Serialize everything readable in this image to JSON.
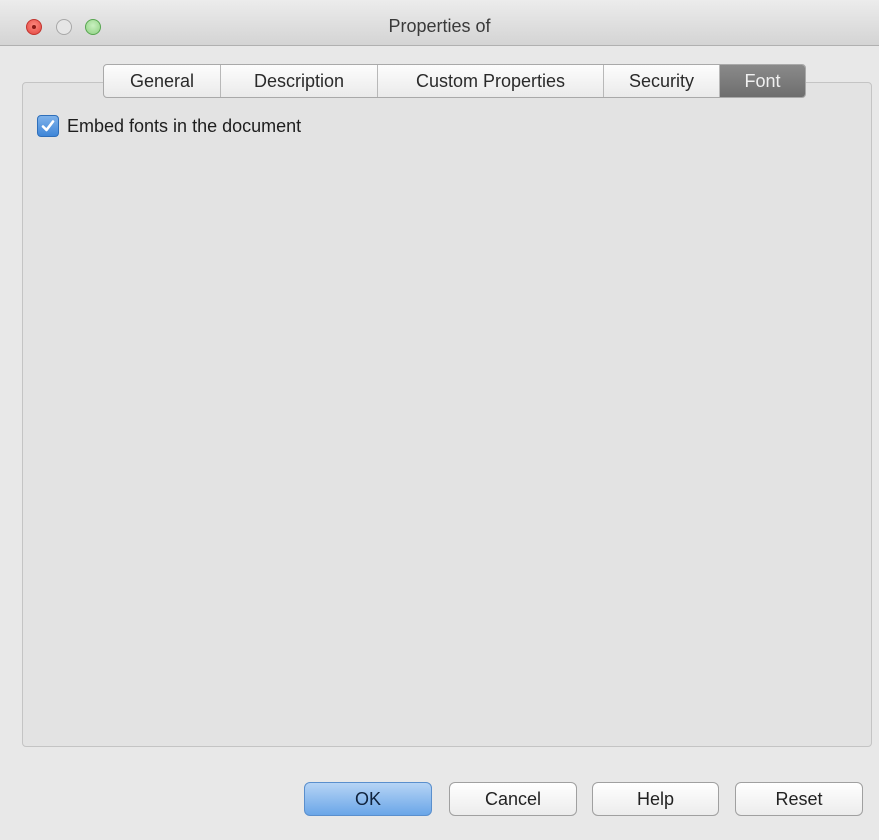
{
  "window": {
    "title": "Properties of"
  },
  "tabs": [
    {
      "label": "General",
      "active": false
    },
    {
      "label": "Description",
      "active": false
    },
    {
      "label": "Custom Properties",
      "active": false
    },
    {
      "label": "Security",
      "active": false
    },
    {
      "label": "Font",
      "active": true
    }
  ],
  "font_tab": {
    "embed_fonts": {
      "label": "Embed fonts in the document",
      "checked": true
    }
  },
  "buttons": {
    "ok": "OK",
    "cancel": "Cancel",
    "help": "Help",
    "reset": "Reset"
  },
  "colors": {
    "accent": "#4a8fdc",
    "active_tab": "#7c7c7c"
  },
  "icons": {
    "close": "close-dot",
    "minimize": "minimize-dot",
    "zoom": "zoom-dot",
    "checkmark": "checkmark"
  }
}
